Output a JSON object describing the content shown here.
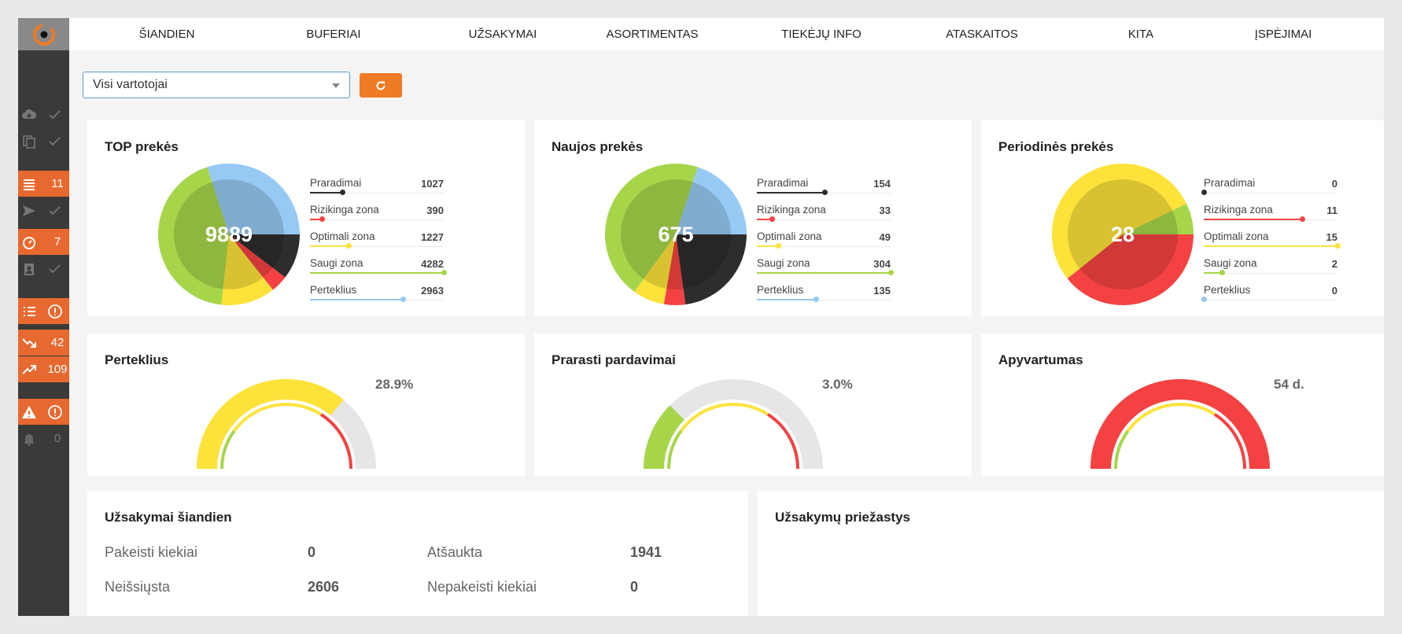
{
  "nav": [
    "ŠIANDIEN",
    "BUFERIAI",
    "UŽSAKYMAI",
    "ASORTIMENTAS",
    "TIEKĖJŲ INFO",
    "ATASKAITOS",
    "KITA",
    "ĮSPĖJIMAI"
  ],
  "sidebar": {
    "items": [
      {
        "icon": "cloud-download-icon",
        "status": "check-icon",
        "value": "",
        "style": "dark"
      },
      {
        "icon": "copy-icon",
        "status": "check-icon",
        "value": "",
        "style": "dark"
      },
      {
        "icon": "list-icon",
        "status": "",
        "value": "11",
        "style": "orange"
      },
      {
        "icon": "send-icon",
        "status": "check-icon",
        "value": "",
        "style": "dark"
      },
      {
        "icon": "timer-icon",
        "status": "",
        "value": "7",
        "style": "orange"
      },
      {
        "icon": "clipboard-user-icon",
        "status": "check-icon",
        "value": "",
        "style": "dark"
      },
      {
        "icon": "bullet-list-icon",
        "status": "alert-circle-icon",
        "value": "",
        "style": "orange"
      },
      {
        "icon": "trending-down-icon",
        "status": "",
        "value": "42",
        "style": "orange"
      },
      {
        "icon": "trending-up-icon",
        "status": "",
        "value": "109",
        "style": "orange"
      },
      {
        "icon": "warning-icon",
        "status": "alert-circle-icon",
        "value": "",
        "style": "orange"
      },
      {
        "icon": "bell-icon",
        "status": "",
        "value": "0",
        "style": "gray"
      }
    ]
  },
  "filter": {
    "selected": "Visi vartotojai"
  },
  "colors": {
    "black": "#2d2d2d",
    "red": "#f44242",
    "yellow": "#fde23a",
    "green": "#a6d54a",
    "blue": "#96c9f3",
    "gray": "#e6e6e6",
    "orange": "#e8692f"
  },
  "legend_labels": [
    "Praradimai",
    "Rizikinga zona",
    "Optimali zona",
    "Saugi zona",
    "Perteklius"
  ],
  "pies": [
    {
      "title": "TOP prekės",
      "total": "9889",
      "outer": [
        1027,
        390,
        1227,
        4282,
        2963
      ],
      "inner": [
        1027,
        390,
        1227,
        4282,
        2963
      ]
    },
    {
      "title": "Naujos prekės",
      "total": "675",
      "outer": [
        154,
        33,
        49,
        304,
        135
      ],
      "inner": [
        154,
        33,
        49,
        304,
        135
      ]
    },
    {
      "title": "Periodinės prekės",
      "total": "28",
      "outer": [
        0,
        11,
        15,
        2,
        0
      ],
      "inner": [
        0,
        11,
        15,
        2,
        0
      ]
    }
  ],
  "gauges": [
    {
      "title": "Perteklius",
      "value": "28.9%",
      "fill": 0.72,
      "color": "yellow"
    },
    {
      "title": "Prarasti pardavimai",
      "value": "3.0%",
      "fill": 0.25,
      "color": "green"
    },
    {
      "title": "Apyvartumas",
      "value": "54 d.",
      "fill": 1.0,
      "color": "red"
    }
  ],
  "orders_today": {
    "title": "Užsakymai šiandien",
    "stats": [
      {
        "label": "Pakeisti kiekiai",
        "value": "0"
      },
      {
        "label": "Atšaukta",
        "value": "1941"
      },
      {
        "label": "Neišsiųsta",
        "value": "2606"
      },
      {
        "label": "Nepakeisti kiekiai",
        "value": "0"
      }
    ]
  },
  "order_reasons": {
    "title": "Užsakymų priežastys"
  }
}
